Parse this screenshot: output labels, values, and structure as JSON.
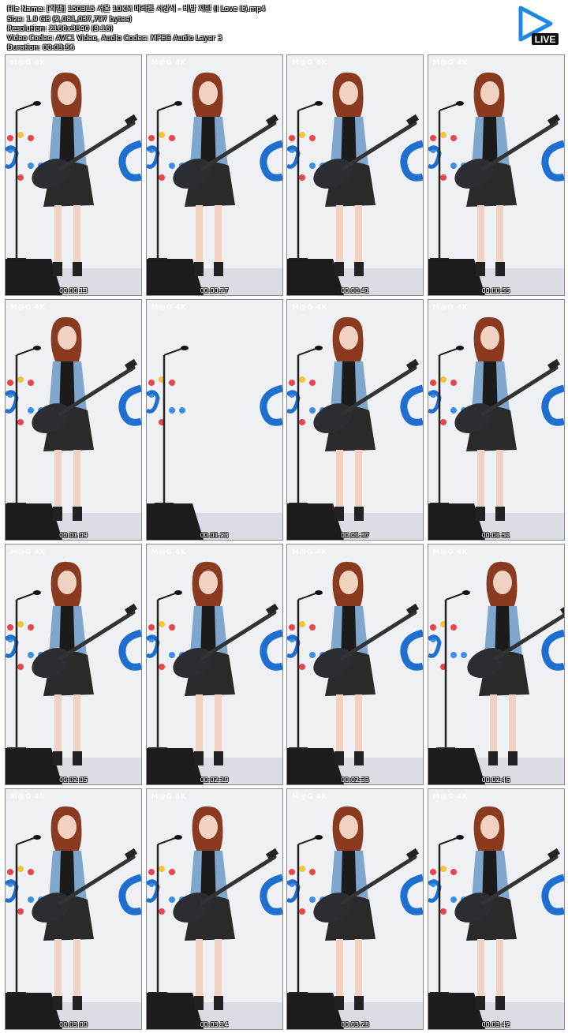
{
  "header": {
    "file_name": "File Name: [직캠] 150315 서울 10KM 마라톤 시상식 - 비밥 지민 (I Love It).mp4",
    "size": "Size: 1.9 GB (2,081,037,797 bytes)",
    "resolution": "Resolution: 2160x3840 (9:16)",
    "codec": "Video Codec: AVC1 Video, Audio Codec: MPEG Audio Layer 3",
    "duration": "Duration: 00:03:56",
    "logo_text": "LIVE"
  },
  "watermark": "M@G 4K",
  "thumbnails": [
    {
      "time": "00:00:13",
      "pose": "center"
    },
    {
      "time": "00:00:27",
      "pose": "center"
    },
    {
      "time": "00:00:41",
      "pose": "center"
    },
    {
      "time": "00:00:55",
      "pose": "center"
    },
    {
      "time": "00:01:09",
      "pose": "center"
    },
    {
      "time": "00:01:23",
      "pose": "empty"
    },
    {
      "time": "00:01:37",
      "pose": "center"
    },
    {
      "time": "00:01:51",
      "pose": "center"
    },
    {
      "time": "00:02:05",
      "pose": "center"
    },
    {
      "time": "00:02:19",
      "pose": "center"
    },
    {
      "time": "00:02:33",
      "pose": "center"
    },
    {
      "time": "00:02:46",
      "pose": "right"
    },
    {
      "time": "00:03:00",
      "pose": "center"
    },
    {
      "time": "00:03:14",
      "pose": "center"
    },
    {
      "time": "00:03:28",
      "pose": "center"
    },
    {
      "time": "00:03:42",
      "pose": "center"
    }
  ],
  "colors": {
    "backdrop": "#eef0f4",
    "brand_blue": "#1f6fd1",
    "dot_red": "#e8464a",
    "dot_yellow": "#f4c534",
    "dot_blue": "#3d8fe6",
    "jacket": "#7fa6cc",
    "hair": "#8a3b1f",
    "skin": "#f1d2c2"
  }
}
